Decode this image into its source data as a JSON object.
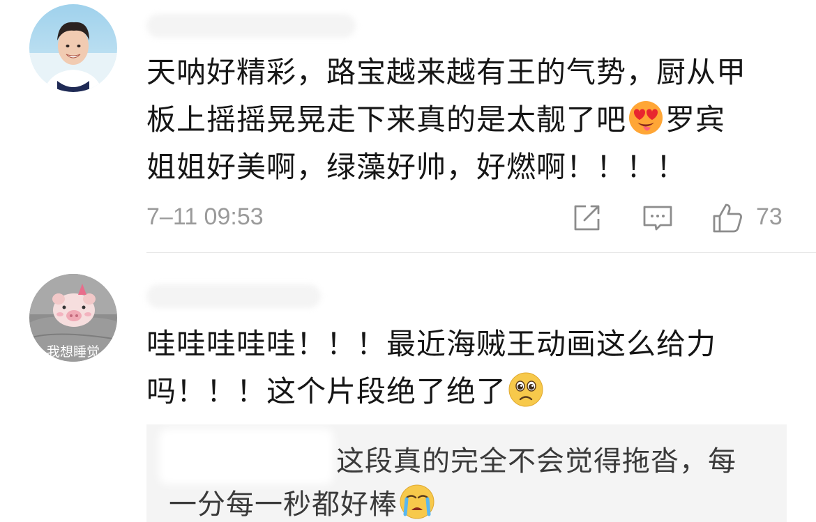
{
  "comments": [
    {
      "avatar": "man-smiling-avatar",
      "lines": [
        "天呐好精彩，路宝越来越有王的气势，厨从甲",
        "板上摇摇晃晃走下来真的是太靓了吧",
        "罗宾",
        "姐姐好美啊，绿藻好帅，好燃啊！！！！"
      ],
      "emoji": "heart-eyes-emoji",
      "timestamp": "7–11 09:53",
      "like_count": "73"
    },
    {
      "avatar": "pig-plush-avatar",
      "avatar_caption": "我想睡觉",
      "lines": [
        "哇哇哇哇哇！！！最近海贼王动画这么给力",
        "吗！！！这个片段绝了绝了"
      ],
      "emoji": "pleading-face-emoji",
      "reply": {
        "lines": [
          "这段真的完全不会觉得拖沓，每",
          "一分每一秒都好棒"
        ],
        "emoji": "crying-face-emoji"
      }
    }
  ],
  "icons": {
    "share": "share-icon",
    "comment": "comment-icon",
    "like": "thumbs-up-icon"
  },
  "colors": {
    "text": "#161616",
    "meta": "#9a9a9a",
    "reply_bg": "#f4f4f4",
    "divider": "#e6e6e6",
    "emoji_yellow": "#f7c94b"
  }
}
